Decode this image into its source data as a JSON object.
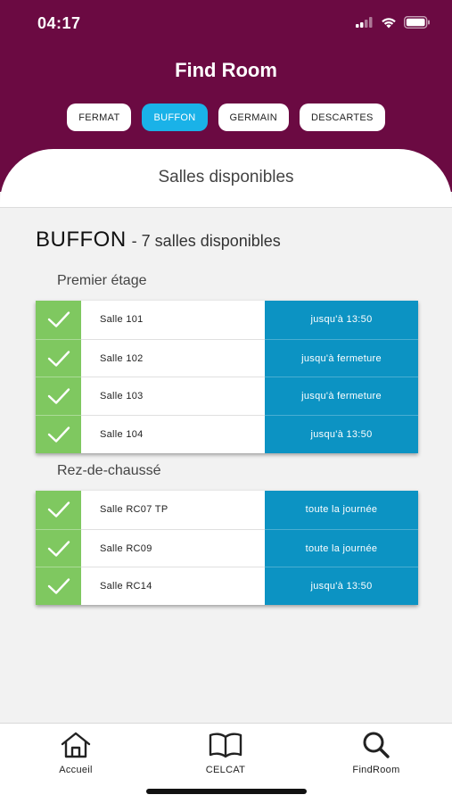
{
  "status": {
    "time": "04:17"
  },
  "app": {
    "title": "Find Room"
  },
  "tabs": [
    {
      "label": "FERMAT",
      "active": false
    },
    {
      "label": "BUFFON",
      "active": true
    },
    {
      "label": "GERMAIN",
      "active": false
    },
    {
      "label": "DESCARTES",
      "active": false
    }
  ],
  "subtitle": "Salles disponibles",
  "building": {
    "name": "BUFFON",
    "count_text": "- 7 salles disponibles"
  },
  "floors": [
    {
      "label": "Premier étage",
      "rooms": [
        {
          "name": "Salle 101",
          "availability": "jusqu'à 13:50"
        },
        {
          "name": "Salle 102",
          "availability": "jusqu'à fermeture"
        },
        {
          "name": "Salle 103",
          "availability": "jusqu'à fermeture"
        },
        {
          "name": "Salle 104",
          "availability": "jusqu'à 13:50"
        }
      ]
    },
    {
      "label": "Rez-de-chaussé",
      "rooms": [
        {
          "name": "Salle RC07 TP",
          "availability": "toute la journée"
        },
        {
          "name": "Salle RC09",
          "availability": "toute la journée"
        },
        {
          "name": "Salle RC14",
          "availability": "jusqu'à 13:50"
        }
      ]
    }
  ],
  "nav": [
    {
      "label": "Accueil",
      "icon": "home-icon"
    },
    {
      "label": "CELCAT",
      "icon": "book-icon"
    },
    {
      "label": "FindRoom",
      "icon": "search-icon"
    }
  ],
  "colors": {
    "header": "#6b0a42",
    "tab_active": "#1ab2e8",
    "check_green": "#7fc860",
    "time_blue": "#0c93c3"
  }
}
